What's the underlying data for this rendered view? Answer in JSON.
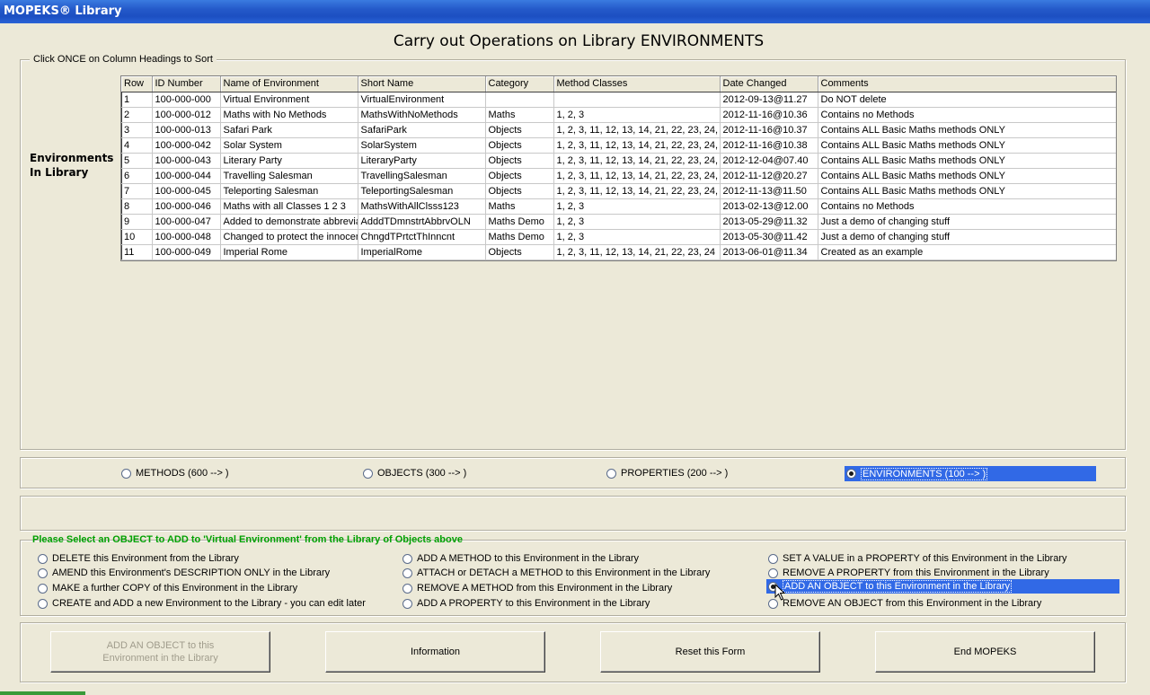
{
  "window": {
    "title": "MOPEKS® Library"
  },
  "page_title": "Carry out Operations on Library ENVIRONMENTS",
  "library_group": {
    "legend": "Click ONCE on Column Headings to Sort",
    "side_label_line1": "Environments",
    "side_label_line2": "In Library"
  },
  "table": {
    "columns": [
      "Row",
      "ID Number",
      "Name of Environment",
      "Short Name",
      "Category",
      "Method Classes",
      "Date Changed",
      "Comments"
    ],
    "rows": [
      [
        "1",
        "100-000-000",
        "Virtual Environment",
        "VirtualEnvironment",
        "",
        "",
        "2012-09-13@11.27",
        "Do NOT delete"
      ],
      [
        "2",
        "100-000-012",
        "Maths with No Methods",
        "MathsWithNoMethods",
        "Maths",
        "1, 2, 3",
        "2012-11-16@10.36",
        "Contains no Methods"
      ],
      [
        "3",
        "100-000-013",
        "Safari Park",
        "SafariPark",
        "Objects",
        "1, 2, 3, 11, 12, 13, 14, 21, 22, 23, 24,",
        "2012-11-16@10.37",
        "Contains ALL Basic Maths methods ONLY"
      ],
      [
        "4",
        "100-000-042",
        "Solar System",
        "SolarSystem",
        "Objects",
        "1, 2, 3, 11, 12, 13, 14, 21, 22, 23, 24,",
        "2012-11-16@10.38",
        "Contains ALL Basic Maths methods ONLY"
      ],
      [
        "5",
        "100-000-043",
        "Literary Party",
        "LiteraryParty",
        "Objects",
        "1, 2, 3, 11, 12, 13, 14, 21, 22, 23, 24,",
        "2012-12-04@07.40",
        "Contains ALL Basic Maths methods ONLY"
      ],
      [
        "6",
        "100-000-044",
        "Travelling Salesman",
        "TravellingSalesman",
        "Objects",
        "1, 2, 3, 11, 12, 13, 14, 21, 22, 23, 24,",
        "2012-11-12@20.27",
        "Contains ALL Basic Maths methods ONLY"
      ],
      [
        "7",
        "100-000-045",
        "Teleporting Salesman",
        "TeleportingSalesman",
        "Objects",
        "1, 2, 3, 11, 12, 13, 14, 21, 22, 23, 24,",
        "2012-11-13@11.50",
        "Contains ALL Basic Maths methods ONLY"
      ],
      [
        "8",
        "100-000-046",
        "Maths with all Classes 1 2 3",
        "MathsWithAllClsss123",
        "Maths",
        "1, 2, 3",
        "2013-02-13@12.00",
        "Contains no Methods"
      ],
      [
        "9",
        "100-000-047",
        "Added to demonstrate abbrevia",
        "AdddTDmnstrtAbbrvOLN",
        "Maths Demo",
        "1, 2, 3",
        "2013-05-29@11.32",
        "Just a demo of changing stuff"
      ],
      [
        "10",
        "100-000-048",
        "Changed to protect the innocen",
        "ChngdTPrtctThInncnt",
        "Maths Demo",
        "1, 2, 3",
        "2013-05-30@11.42",
        "Just a demo of changing stuff"
      ],
      [
        "11",
        "100-000-049",
        "Imperial Rome",
        "ImperialRome",
        "Objects",
        "1, 2, 3, 11, 12, 13, 14, 21, 22, 23, 24",
        "2013-06-01@11.34",
        "Created as an example"
      ]
    ]
  },
  "library_types": [
    {
      "label": "METHODS (600 --> )",
      "checked": false
    },
    {
      "label": "OBJECTS (300 --> )",
      "checked": false
    },
    {
      "label": "PROPERTIES (200 --> )",
      "checked": false
    },
    {
      "label": "ENVIRONMENTS (100 --> )",
      "checked": true
    }
  ],
  "operations": {
    "instruction": "Please Select an OBJECT to ADD to 'Virtual Environment' from the Library of Objects above",
    "items": [
      {
        "label": "DELETE this Environment from the Library",
        "checked": false
      },
      {
        "label": "AMEND this Environment's DESCRIPTION ONLY in the Library",
        "checked": false
      },
      {
        "label": "MAKE a further COPY of this Environment in the Library",
        "checked": false
      },
      {
        "label": "CREATE and ADD a new Environment to the Library - you can edit later",
        "checked": false
      },
      {
        "label": "ADD A METHOD to this Environment in the Library",
        "checked": false
      },
      {
        "label": "ATTACH or DETACH a METHOD to this Environment in the Library",
        "checked": false
      },
      {
        "label": "REMOVE A METHOD from this Environment in the Library",
        "checked": false
      },
      {
        "label": "ADD A PROPERTY to this Environment in the Library",
        "checked": false
      },
      {
        "label": "SET A VALUE in a PROPERTY of this Environment in the Library",
        "checked": false
      },
      {
        "label": "REMOVE A PROPERTY from this Environment in the Library",
        "checked": false
      },
      {
        "label": "ADD AN OBJECT to this Environment in the Library",
        "checked": true
      },
      {
        "label": "REMOVE  AN OBJECT from this Environment in the Library",
        "checked": false
      }
    ]
  },
  "buttons": {
    "primary_line1": "ADD AN OBJECT to this",
    "primary_line2": "Environment in the Library",
    "information": "Information",
    "reset": "Reset this Form",
    "end": "End MOPEKS"
  },
  "colors": {
    "title_bar": "#2459c9",
    "selection": "#3169e6",
    "instruction_text": "#00a000",
    "background": "#ECE9D8"
  }
}
